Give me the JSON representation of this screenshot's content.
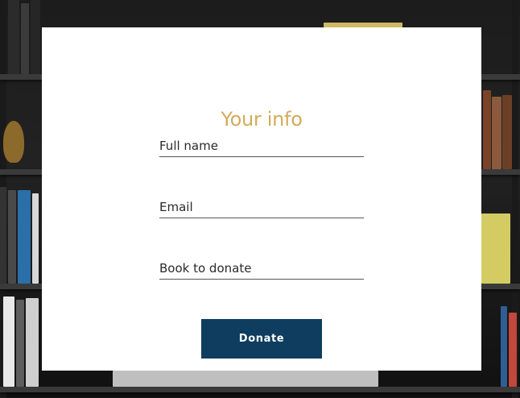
{
  "form": {
    "title": "Your info",
    "fields": [
      {
        "name": "full-name",
        "placeholder": "Full name",
        "value": ""
      },
      {
        "name": "email",
        "placeholder": "Email",
        "value": ""
      },
      {
        "name": "book",
        "placeholder": "Book to donate",
        "value": ""
      }
    ],
    "submit_label": "Donate"
  },
  "colors": {
    "title": "#d3ab5a",
    "button": "#0f3d5f",
    "underline": "#555555",
    "card": "#ffffff"
  }
}
